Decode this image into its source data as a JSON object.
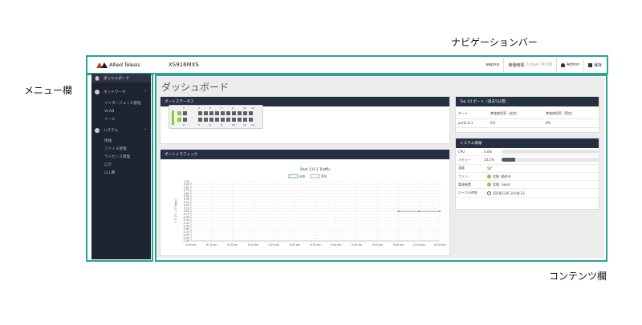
{
  "callouts": {
    "navigation_bar": "ナビゲーションバー",
    "menu_column": "メニュー欄",
    "content_column": "コンテンツ欄"
  },
  "navbar": {
    "brand": "Allied Telesis",
    "model": "XS916MXS",
    "user_host": "awplus",
    "elapsed_label": "稼働時間",
    "elapsed_value": "0 days 00:09",
    "admin_label": "Admin",
    "save_label": "保存"
  },
  "sidebar": {
    "dashboard": "ダッシュボード",
    "network": "ネットワーク",
    "network_items": [
      "インターフェース管理",
      "VLAN",
      "ツール"
    ],
    "system": "システム",
    "system_items": [
      "情報",
      "ファイル管理",
      "ライセンス管理",
      "ログ",
      "CLI 🗗"
    ]
  },
  "content": {
    "page_title": "ダッシュボード",
    "port_status": {
      "title": "ポートステータス",
      "top_labels": [
        "1",
        "3",
        "5",
        "7",
        "9",
        "11",
        "13"
      ],
      "bottom_labels": [
        "2",
        "4",
        "6",
        "8",
        "10",
        "12",
        "14"
      ]
    },
    "port_traffic": {
      "title": "ポートトラフィック"
    },
    "top10": {
      "title": "Top 10 ポート（過去5分間）",
      "headers": [
        "ポート",
        "帯域使用率（送信）",
        "帯域使用率（受信）"
      ],
      "rows": [
        [
          "port1.0.1",
          "0%",
          "0%"
        ]
      ]
    },
    "system_info": {
      "title": "システム情報",
      "cpu_label": "CPU",
      "cpu_value": "0.0%",
      "memory_label": "メモリー",
      "memory_value": "14.1%",
      "temp_label": "温度",
      "temp_value": "50°",
      "fan_label": "ファン",
      "fan_value": "状態: 動作中",
      "psu_label": "電源装置",
      "psu_value": "状態: Good",
      "localtime_label": "ローカル時刻",
      "localtime_value": "2018/1/26 10:08:23"
    }
  },
  "chart_data": {
    "type": "line",
    "title": "Port 1.0.1 Traffic",
    "legend": [
      "送信",
      "受信"
    ],
    "legend_position": "top-center",
    "ylabel": "トラフィック (bps)",
    "xlabel": "",
    "x": [
      "9:09 am",
      "9:14 am",
      "9:19 am",
      "9:24 am",
      "9:29 am",
      "9:34 am",
      "9:39 am",
      "9:44 am",
      "9:49 am",
      "9:54 am",
      "9:59 am",
      "10:04 am",
      "10:09 am"
    ],
    "y_ticks": [
      "1.00",
      "0.90",
      "0.80",
      "0.70",
      "0.60",
      "0.50",
      "0.40",
      "0.30",
      "0.20",
      "0.10",
      "0.00",
      "-0.10",
      "-0.20",
      "-0.30",
      "-0.40",
      "-0.50",
      "-0.60",
      "-0.70",
      "-0.80",
      "-0.90",
      "-1.00"
    ],
    "ylim": [
      -1.0,
      1.0
    ],
    "grid": true,
    "series": [
      {
        "name": "送信",
        "color": "#4a90c9",
        "values": [
          null,
          null,
          null,
          null,
          null,
          null,
          null,
          null,
          null,
          null,
          0,
          0,
          0
        ]
      },
      {
        "name": "受信",
        "color": "#d678c4",
        "values": [
          null,
          null,
          null,
          null,
          null,
          null,
          null,
          null,
          null,
          null,
          0,
          0,
          0
        ]
      }
    ]
  },
  "colors": {
    "frame": "#29a394",
    "sidebar_bg": "#1e2330",
    "panel_head": "#263042",
    "port_up": "#8dc63f",
    "port_down": "#5a5f68"
  }
}
